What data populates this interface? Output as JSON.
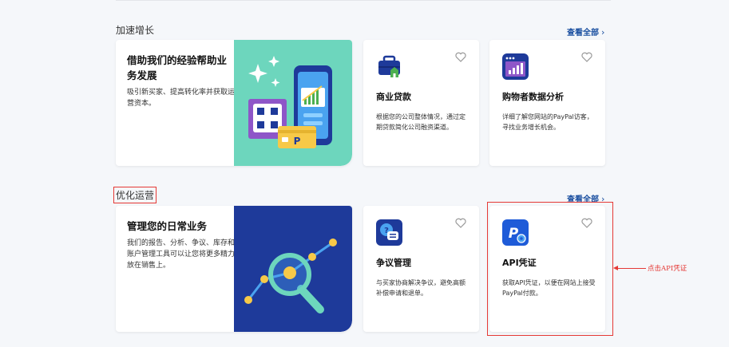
{
  "sections": [
    {
      "title": "加速增长",
      "view_all": "查看全部",
      "feature": {
        "title": "借助我们的经验帮助业务发展",
        "desc": "吸引新买家、提高转化率并获取运营资本。"
      },
      "cards": [
        {
          "title": "商业贷款",
          "desc": "根据您的公司整体情况，通过定期贷款简化公司融资渠道。",
          "icon": "briefcase-icon"
        },
        {
          "title": "购物者数据分析",
          "desc": "详细了解您网站的PayPal访客，寻找业务增长机会。",
          "icon": "analytics-icon"
        }
      ]
    },
    {
      "title": "优化运营",
      "view_all": "查看全部",
      "feature": {
        "title": "管理您的日常业务",
        "desc": "我们的报告、分析、争议、库存和账户管理工具可以让您将更多精力放在销售上。"
      },
      "cards": [
        {
          "title": "争议管理",
          "desc": "与买家协商解决争议，避免高额补偿申请和退单。",
          "icon": "dispute-icon"
        },
        {
          "title": "API凭证",
          "desc": "获取API凭证，以便在网站上接受PayPal付款。",
          "icon": "paypal-gear-icon"
        }
      ]
    }
  ],
  "annotation": "点击API凭证",
  "colors": {
    "teal": "#6dd6bd",
    "navy": "#1e3a9a",
    "link": "#1a4fa0",
    "highlight": "#e53935"
  }
}
